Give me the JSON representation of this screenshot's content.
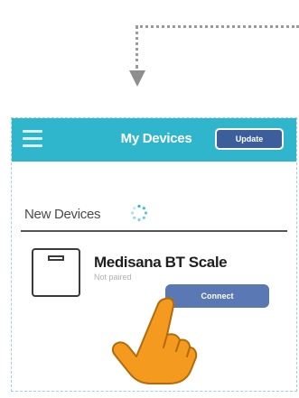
{
  "header": {
    "title": "My Devices",
    "update_label": "Update"
  },
  "section": {
    "label": "New Devices"
  },
  "device": {
    "name": "Medisana BT Scale",
    "status": "Not paired",
    "connect_label": "Connect"
  },
  "icons": {
    "menu": "menu-icon",
    "spinner": "spinner-icon",
    "scale": "scale-icon",
    "hand": "pointing-hand-icon",
    "arrow": "arrow-down-icon"
  },
  "colors": {
    "topbar": "#2fb6cc",
    "update_button": "#3c5f9c",
    "connect_button": "#5a78b4",
    "hand": "#f39a1f"
  }
}
